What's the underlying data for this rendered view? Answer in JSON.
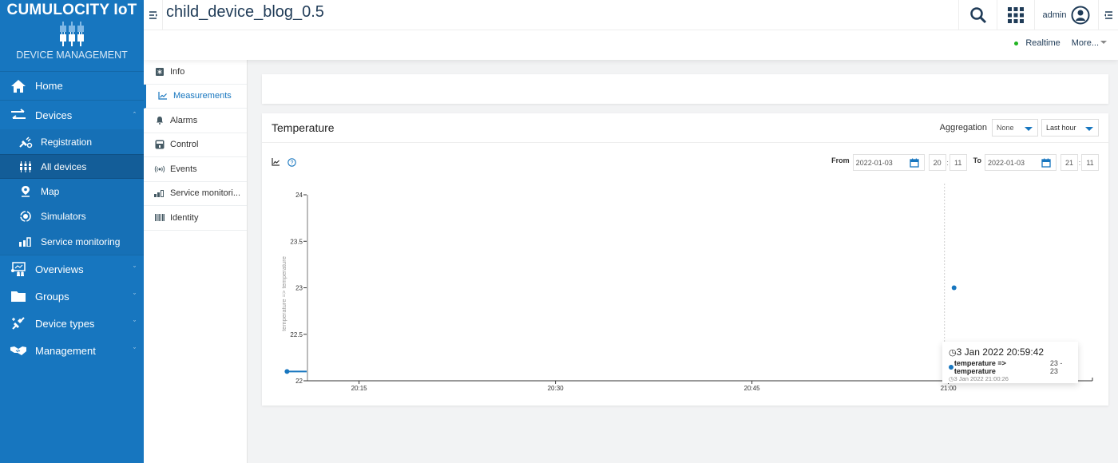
{
  "brand": {
    "title": "CUMULOCITY IoT",
    "subtitle": "DEVICE MANAGEMENT"
  },
  "sidebar": {
    "home": {
      "label": "Home",
      "icon": "home-icon"
    },
    "devices": {
      "label": "Devices",
      "icon": "exchange-icon",
      "expanded": true,
      "items": [
        {
          "label": "Registration",
          "icon": "plug-icon"
        },
        {
          "label": "All devices",
          "icon": "devices-icon",
          "active": true
        },
        {
          "label": "Map",
          "icon": "map-pin-icon"
        },
        {
          "label": "Simulators",
          "icon": "simulator-icon"
        },
        {
          "label": "Service monitoring",
          "icon": "signal-bars-icon"
        }
      ]
    },
    "groups": [
      {
        "label": "Overviews",
        "icon": "presentation-icon"
      },
      {
        "label": "Groups",
        "icon": "folder-icon"
      },
      {
        "label": "Device types",
        "icon": "plug-connect-icon"
      },
      {
        "label": "Management",
        "icon": "handshake-icon"
      }
    ]
  },
  "header": {
    "title": "child_device_blog_0.5",
    "user": "admin",
    "realtime_label": "Realtime",
    "more_label": "More...",
    "realtime_color": "#22b422"
  },
  "tabs": [
    {
      "label": "Info",
      "icon": "info-icon"
    },
    {
      "label": "Measurements",
      "icon": "line-chart-icon",
      "active": true
    },
    {
      "label": "Alarms",
      "icon": "bell-icon"
    },
    {
      "label": "Control",
      "icon": "control-icon"
    },
    {
      "label": "Events",
      "icon": "broadcast-icon"
    },
    {
      "label": "Service monitori...",
      "icon": "signal-bars-icon"
    },
    {
      "label": "Identity",
      "icon": "barcode-icon"
    }
  ],
  "measurement_card": {
    "title": "Temperature",
    "aggregation_label": "Aggregation",
    "aggregation_value": "None",
    "interval_value": "Last hour",
    "from_label": "From",
    "from_date": "2022-01-03",
    "from_hour": "20",
    "from_minute": "11",
    "to_label": "To",
    "to_date": "2022-01-03",
    "to_hour": "21",
    "to_minute": "11"
  },
  "chart_data": {
    "type": "scatter",
    "title": "Temperature",
    "xlabel": "",
    "ylabel": "temperature => temperature",
    "x_range": [
      "20:11",
      "21:11"
    ],
    "x_ticks": [
      "20:15",
      "20:30",
      "20:45",
      "21:00"
    ],
    "ylim": [
      22,
      24
    ],
    "y_ticks": [
      "22",
      "22.5",
      "23",
      "23.5",
      "24"
    ],
    "grid": false,
    "series": [
      {
        "name": "temperature => temperature",
        "color": "#1776bf",
        "points": [
          {
            "x": "20:09:30",
            "y": 22.1
          },
          {
            "x": "21:00:26",
            "y": 23
          }
        ]
      }
    ],
    "crosshair_x": "20:59:42",
    "tooltip": {
      "time": "3 Jan 2022 20:59:42",
      "series": "temperature => temperature",
      "value": "23 - 23",
      "sub_time": "3 Jan 2022 21:00:26"
    }
  }
}
